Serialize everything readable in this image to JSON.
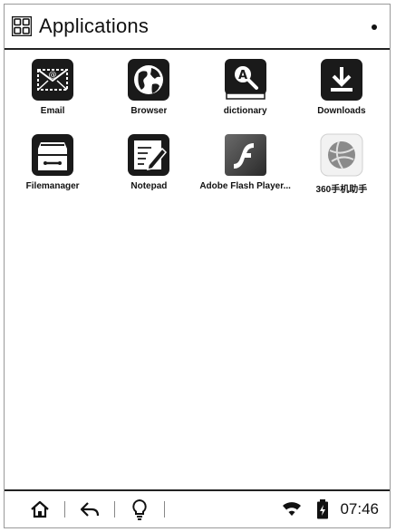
{
  "header": {
    "title": "Applications"
  },
  "apps": [
    {
      "label": "Email",
      "icon": "email-icon"
    },
    {
      "label": "Browser",
      "icon": "globe-icon"
    },
    {
      "label": "dictionary",
      "icon": "dictionary-icon"
    },
    {
      "label": "Downloads",
      "icon": "download-icon"
    },
    {
      "label": "Filemanager",
      "icon": "file-cabinet-icon"
    },
    {
      "label": "Notepad",
      "icon": "notepad-icon"
    },
    {
      "label": "Adobe Flash Player...",
      "icon": "flash-icon"
    },
    {
      "label": "360手机助手",
      "icon": "ball-icon"
    }
  ],
  "statusbar": {
    "time": "07:46",
    "icons": [
      "home-icon",
      "back-icon",
      "lightbulb-icon",
      "wifi-icon",
      "battery-icon"
    ]
  }
}
